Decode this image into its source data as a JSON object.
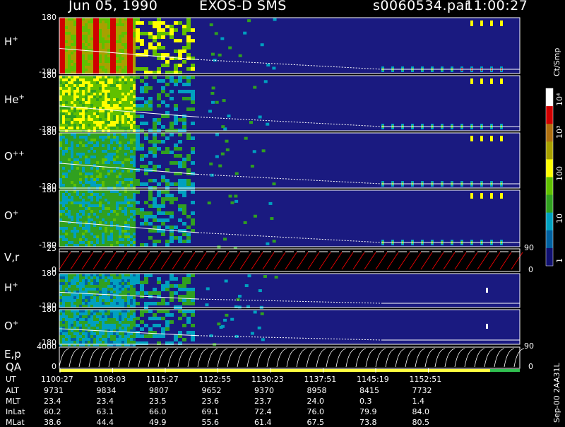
{
  "header": {
    "date": "Jun 05, 1990",
    "instrument": "EXOS-D SMS",
    "file": "s0060534.par",
    "time": "11:00:27"
  },
  "chart_data": {
    "type": "heatmap",
    "panels": [
      {
        "ion": "H",
        "charge": "+",
        "ylim": [
          -180,
          180
        ],
        "tick_top": "180",
        "tick_bottom": "-180"
      },
      {
        "ion": "He",
        "charge": "+",
        "ylim": [
          -180,
          180
        ],
        "tick_top": "180",
        "tick_bottom": "-180"
      },
      {
        "ion": "O",
        "charge": "++",
        "ylim": [
          -180,
          180
        ],
        "tick_top": "180",
        "tick_bottom": "-180"
      },
      {
        "ion": "O",
        "charge": "+",
        "ylim": [
          -180,
          180
        ],
        "tick_top": "180",
        "tick_bottom": "-180"
      },
      {
        "ion": "V,r",
        "charge": "",
        "ylim": [
          0,
          25
        ],
        "tick_top": "25",
        "tick_bottom": "0",
        "right_top": "90",
        "right_bottom": "0"
      },
      {
        "ion": "H",
        "charge": "+",
        "ylim": [
          -180,
          180
        ],
        "tick_top": "180",
        "tick_bottom": "-180"
      },
      {
        "ion": "O",
        "charge": "+",
        "ylim": [
          -180,
          180
        ],
        "tick_top": "180",
        "tick_bottom": "-180"
      },
      {
        "ion": "E,p",
        "charge": "",
        "ylim": [
          0,
          4000
        ],
        "tick_top": "4000",
        "tick_bottom": "0",
        "right_top": "90",
        "right_bottom": "0"
      }
    ],
    "qa_label": "QA",
    "colorbar": {
      "unit": "Ct/Smp",
      "scale": "log",
      "range": [
        1,
        10000
      ],
      "labels": [
        "10⁴",
        "10³",
        "100",
        "10",
        "1"
      ],
      "colors": [
        "#ffffff",
        "#d00000",
        "#b07010",
        "#a8a000",
        "#ffff00",
        "#60c000",
        "#30a020",
        "#00a0c0",
        "#0060a0",
        "#101070"
      ]
    },
    "time_axis": {
      "label": "UT",
      "ticks": [
        "1100:27",
        "1108:03",
        "1115:27",
        "1122:55",
        "1130:23",
        "1137:51",
        "1145:19",
        "1152:51"
      ]
    },
    "ephemeris": [
      {
        "name": "ALT",
        "values": [
          "9731",
          "9834",
          "9807",
          "9652",
          "9370",
          "8958",
          "8415",
          "7732"
        ]
      },
      {
        "name": "MLT",
        "values": [
          "23.4",
          "23.4",
          "23.5",
          "23.6",
          "23.7",
          "24.0",
          "0.3",
          "1.4"
        ]
      },
      {
        "name": "InLat",
        "values": [
          "60.2",
          "63.1",
          "66.0",
          "69.1",
          "72.4",
          "76.0",
          "79.9",
          "84.0"
        ]
      },
      {
        "name": "MLat",
        "values": [
          "38.6",
          "44.4",
          "49.9",
          "55.6",
          "61.4",
          "67.5",
          "73.8",
          "80.5"
        ]
      }
    ],
    "footer_note": "Sep-00 2AA31L"
  }
}
